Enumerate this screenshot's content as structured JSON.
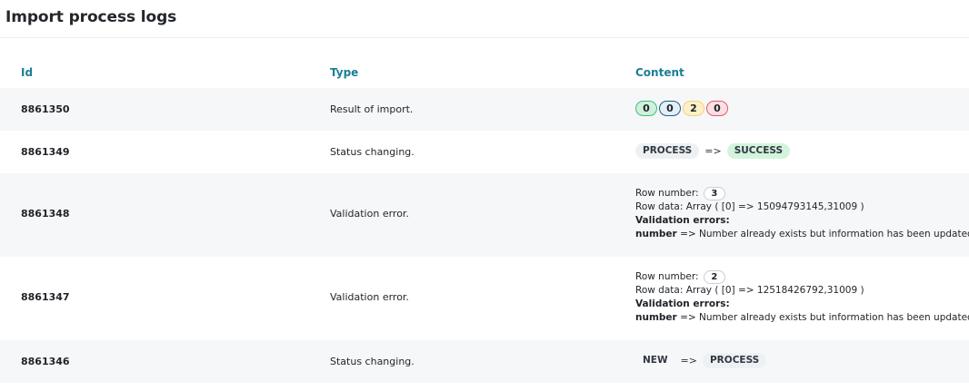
{
  "page": {
    "title": "Import process logs"
  },
  "table": {
    "columns": {
      "id": "Id",
      "type": "Type",
      "content": "Content"
    },
    "rows": [
      {
        "id": "8861350",
        "type": "Result of import.",
        "counts": [
          "0",
          "0",
          "2",
          "0"
        ]
      },
      {
        "id": "8861349",
        "type": "Status changing.",
        "from": "PROCESS",
        "arrow": "=>",
        "to": "SUCCESS"
      },
      {
        "id": "8861348",
        "type": "Validation error.",
        "row_number_label": "Row number:",
        "row_number": "3",
        "row_data": "Row data: Array ( [0] => 15094793145,31009 )",
        "errors_label": "Validation errors:",
        "error_field": "number",
        "error_text": "=> Number already exists but information has been updated"
      },
      {
        "id": "8861347",
        "type": "Validation error.",
        "row_number_label": "Row number:",
        "row_number": "2",
        "row_data": "Row data: Array ( [0] => 12518426792,31009 )",
        "errors_label": "Validation errors:",
        "error_field": "number",
        "error_text": "=> Number already exists but information has been updated"
      },
      {
        "id": "8861346",
        "type": "Status changing.",
        "from": "NEW",
        "arrow": "=>",
        "to": "PROCESS"
      }
    ]
  },
  "colors": {
    "header_accent": "#1b7f95",
    "success": "#3fbf75",
    "info": "#1f5f84",
    "warning": "#f1d27c",
    "danger": "#e3596c"
  }
}
